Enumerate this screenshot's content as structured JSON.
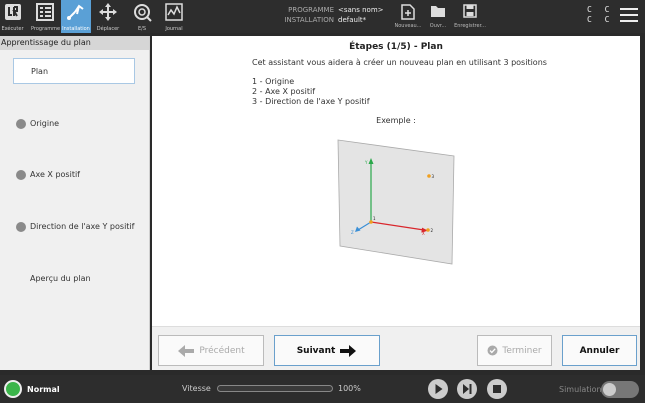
{
  "topbar": {
    "nav": [
      {
        "label": "Exécuter",
        "icon": "ur-logo-icon"
      },
      {
        "label": "Programme",
        "icon": "program-icon"
      },
      {
        "label": "Installation",
        "icon": "installation-icon"
      },
      {
        "label": "Déplacer",
        "icon": "move-arrows-icon"
      },
      {
        "label": "E/S",
        "icon": "io-icon"
      },
      {
        "label": "Journal",
        "icon": "log-chart-icon"
      }
    ],
    "program_label": "PROGRAMME",
    "installation_label": "INSTALLATION",
    "program_value": "<sans nom>",
    "installation_value": "default*",
    "file_buttons": [
      {
        "label": "Nouveau...",
        "icon": "new-file-icon"
      },
      {
        "label": "Ouvr...",
        "icon": "folder-icon"
      },
      {
        "label": "Enregistrer...",
        "icon": "save-icon"
      }
    ],
    "cc_glyphs": "C C C C"
  },
  "sidebar": {
    "title": "Apprentissage du plan",
    "items": [
      {
        "label": "Plan",
        "state": "selected"
      },
      {
        "label": "Origine",
        "state": "pending"
      },
      {
        "label": "Axe X positif",
        "state": "pending"
      },
      {
        "label": "Direction de l'axe Y positif",
        "state": "pending"
      },
      {
        "label": "Aperçu du plan",
        "state": "none"
      }
    ]
  },
  "main": {
    "title": "Étapes (1/5) - Plan",
    "intro": "Cet assistant vous aidera à créer un nouveau plan en utilisant 3 positions",
    "steps": [
      "1 - Origine",
      "2 - Axe X positif",
      "3 - Direction de l'axe Y positif"
    ],
    "example_label": "Exemple :",
    "diagram": {
      "y_label": "Y",
      "x_label": "X",
      "z_label": "Z",
      "point_1": "1",
      "point_2": "2",
      "point_3": "3",
      "colors": {
        "y_axis": "#2aa84a",
        "x_axis": "#d9262c",
        "z_axis": "#3a8fd6",
        "point": "#f0a020",
        "plane": "#e4e4e4"
      }
    }
  },
  "buttons": {
    "previous": "Précédent",
    "next": "Suivant",
    "finish": "Terminer",
    "cancel": "Annuler"
  },
  "statusbar": {
    "status": "Normal",
    "speed_label": "Vitesse",
    "speed_value": "100%",
    "simulation_label": "Simulation",
    "status_color": "#3bb54a"
  }
}
